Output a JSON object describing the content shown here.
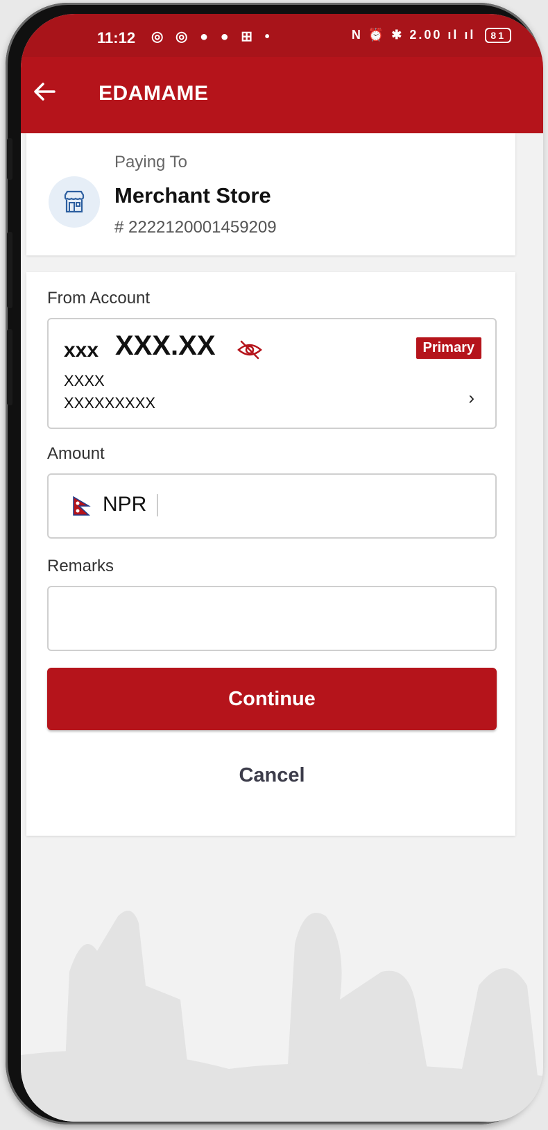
{
  "status_bar": {
    "time": "11:12",
    "left_icons": "◎ ◎ ● ● ⊞ •",
    "right_icons": "N ⏰ ✱ 2.00 ıl ıl",
    "battery": "81"
  },
  "app_bar": {
    "title": "EDAMAME"
  },
  "merchant": {
    "paying_label": "Paying To",
    "name": "Merchant Store",
    "id": "# 2222120001459209"
  },
  "from_account": {
    "label": "From Account",
    "currency": "xxx",
    "balance": "XXX.XX",
    "badge": "Primary",
    "account_name": "XXXX",
    "account_number": "XXXXXXXXX"
  },
  "amount": {
    "label": "Amount",
    "currency": "NPR"
  },
  "remarks": {
    "label": "Remarks",
    "placeholder": ""
  },
  "buttons": {
    "continue": "Continue",
    "cancel": "Cancel"
  },
  "colors": {
    "brand_red": "#b5141b",
    "status_red": "#a8141a"
  }
}
